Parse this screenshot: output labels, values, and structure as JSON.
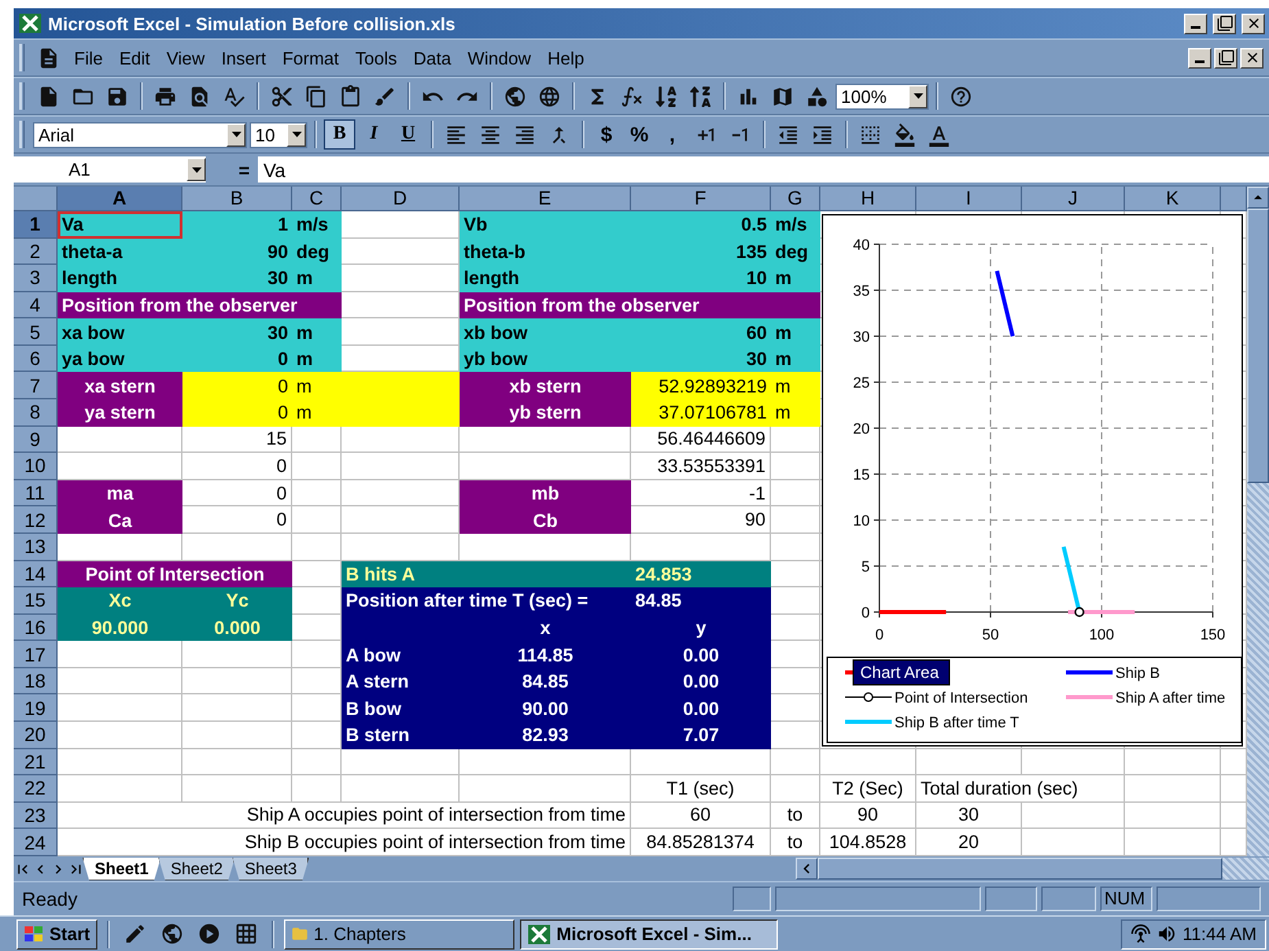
{
  "window": {
    "title": "Microsoft Excel - Simulation Before collision.xls"
  },
  "menu": [
    "File",
    "Edit",
    "View",
    "Insert",
    "Format",
    "Tools",
    "Data",
    "Window",
    "Help"
  ],
  "standard_toolbar": {
    "zoom": "100%"
  },
  "formatting_toolbar": {
    "font": "Arial",
    "size": "10",
    "style_buttons": [
      {
        "label": "B",
        "pressed": true
      },
      {
        "label": "I",
        "pressed": false
      },
      {
        "label": "U",
        "pressed": false
      }
    ],
    "number_buttons": [
      "$",
      "%",
      ","
    ]
  },
  "formula_bar": {
    "name_box": "A1",
    "equals": "=",
    "content": "Va"
  },
  "sheet": {
    "columns": [
      "A",
      "B",
      "C",
      "D",
      "E",
      "F",
      "G",
      "H",
      "I",
      "J",
      "K"
    ],
    "rows": [
      {
        "label": "1",
        "cells": [
          {
            "text": "Va",
            "kind": "label",
            "color": "#33cccc",
            "bold": true,
            "selected": true
          },
          {
            "text": "1",
            "kind": "number",
            "color": "#33cccc",
            "bold": true
          },
          {
            "text": "m/s",
            "kind": "label",
            "color": "#33cccc",
            "bold": true
          },
          {
            "kind": "empty"
          },
          {
            "text": "Vb",
            "kind": "label",
            "color": "#33cccc",
            "bold": true
          },
          {
            "text": "0.5",
            "kind": "number",
            "color": "#33cccc",
            "bold": true
          },
          {
            "text": "m/s",
            "kind": "label",
            "color": "#33cccc",
            "bold": true
          }
        ]
      },
      {
        "label": "2",
        "cells": [
          {
            "text": "theta-a",
            "kind": "label",
            "color": "#33cccc",
            "bold": true
          },
          {
            "text": "90",
            "kind": "number",
            "color": "#33cccc",
            "bold": true
          },
          {
            "text": "deg",
            "kind": "label",
            "color": "#33cccc",
            "bold": true
          },
          {
            "kind": "empty"
          },
          {
            "text": "theta-b",
            "kind": "label",
            "color": "#33cccc",
            "bold": true
          },
          {
            "text": "135",
            "kind": "number",
            "color": "#33cccc",
            "bold": true
          },
          {
            "text": "deg",
            "kind": "label",
            "color": "#33cccc",
            "bold": true
          }
        ]
      },
      {
        "label": "3",
        "cells": [
          {
            "text": "length",
            "kind": "label",
            "color": "#33cccc",
            "bold": true
          },
          {
            "text": "30",
            "kind": "number",
            "color": "#33cccc",
            "bold": true
          },
          {
            "text": "m",
            "kind": "label",
            "color": "#33cccc",
            "bold": true
          },
          {
            "kind": "empty"
          },
          {
            "text": "length",
            "kind": "label",
            "color": "#33cccc",
            "bold": true
          },
          {
            "text": "10",
            "kind": "number",
            "color": "#33cccc",
            "bold": true
          },
          {
            "text": "m",
            "kind": "label",
            "color": "#33cccc",
            "bold": true
          }
        ]
      },
      {
        "label": "4",
        "cells": [
          {
            "text": "Position from the observer",
            "kind": "label",
            "color": "#800080",
            "bold": true
          },
          {
            "joined": true
          },
          {
            "joined": true
          },
          {
            "kind": "empty"
          },
          {
            "text": "Position from the observer",
            "kind": "label",
            "color": "#800080",
            "bold": true
          },
          {
            "joined": true
          },
          {
            "joined": true
          }
        ]
      },
      {
        "label": "5",
        "cells": [
          {
            "text": "xa bow",
            "kind": "label",
            "color": "#33cccc",
            "bold": true
          },
          {
            "text": "30",
            "kind": "number",
            "color": "#33cccc",
            "bold": true
          },
          {
            "text": "m",
            "kind": "label",
            "color": "#33cccc",
            "bold": true
          },
          {
            "kind": "empty"
          },
          {
            "text": "xb bow",
            "kind": "label",
            "color": "#33cccc",
            "bold": true
          },
          {
            "text": "60",
            "kind": "number",
            "color": "#33cccc",
            "bold": true
          },
          {
            "text": "m",
            "kind": "label",
            "color": "#33cccc",
            "bold": true
          }
        ]
      },
      {
        "label": "6",
        "cells": [
          {
            "text": "ya bow",
            "kind": "label",
            "color": "#33cccc",
            "bold": true
          },
          {
            "text": "0",
            "kind": "number",
            "color": "#33cccc",
            "bold": true
          },
          {
            "text": "m",
            "kind": "label",
            "color": "#33cccc",
            "bold": true
          },
          {
            "kind": "empty"
          },
          {
            "text": "yb bow",
            "kind": "label",
            "color": "#33cccc",
            "bold": true
          },
          {
            "text": "30",
            "kind": "number",
            "color": "#33cccc",
            "bold": true
          },
          {
            "text": "m",
            "kind": "label",
            "color": "#33cccc",
            "bold": true
          }
        ]
      },
      {
        "label": "7",
        "cells": [
          {
            "text": "xa stern",
            "kind": "centered",
            "color": "#800080",
            "bold": true
          },
          {
            "text": "0",
            "kind": "number",
            "color": "#ffff00",
            "bold": false
          },
          {
            "text": "m",
            "kind": "label",
            "color": "#ffff00",
            "bold": false
          },
          {
            "kind": "empty",
            "color": "#ffff00"
          },
          {
            "text": "xb stern",
            "kind": "centered",
            "color": "#800080",
            "bold": true
          },
          {
            "text": "52.92893219",
            "kind": "number",
            "color": "#ffff00",
            "bold": false
          },
          {
            "text": "m",
            "kind": "label",
            "color": "#ffff00",
            "bold": false
          }
        ]
      },
      {
        "label": "8",
        "cells": [
          {
            "text": "ya stern",
            "kind": "centered",
            "color": "#800080",
            "bold": true
          },
          {
            "text": "0",
            "kind": "number",
            "color": "#ffff00",
            "bold": false
          },
          {
            "text": "m",
            "kind": "label",
            "color": "#ffff00",
            "bold": false
          },
          {
            "kind": "empty",
            "color": "#ffff00"
          },
          {
            "text": "yb stern",
            "kind": "centered",
            "color": "#800080",
            "bold": true
          },
          {
            "text": "37.07106781",
            "kind": "number",
            "color": "#ffff00",
            "bold": false
          },
          {
            "text": "m",
            "kind": "label",
            "color": "#ffff00",
            "bold": false
          }
        ]
      },
      {
        "label": "9",
        "cells": [
          {
            "kind": "empty"
          },
          {
            "text": "15",
            "kind": "number"
          },
          {
            "kind": "empty"
          },
          {
            "kind": "empty"
          },
          {
            "kind": "empty"
          },
          {
            "text": "56.46446609",
            "kind": "number"
          }
        ]
      },
      {
        "label": "10",
        "cells": [
          {
            "kind": "empty"
          },
          {
            "text": "0",
            "kind": "number"
          },
          {
            "kind": "empty"
          },
          {
            "kind": "empty"
          },
          {
            "kind": "empty"
          },
          {
            "text": "33.53553391",
            "kind": "number"
          }
        ]
      },
      {
        "label": "11",
        "cells": [
          {
            "text": "ma",
            "kind": "centered",
            "color": "#800080",
            "bold": true
          },
          {
            "text": "0",
            "kind": "number"
          },
          {
            "kind": "empty"
          },
          {
            "kind": "empty"
          },
          {
            "text": "mb",
            "kind": "centered",
            "color": "#800080",
            "bold": true
          },
          {
            "text": "-1",
            "kind": "number"
          }
        ]
      },
      {
        "label": "12",
        "cells": [
          {
            "text": "Ca",
            "kind": "centered",
            "color": "#800080",
            "bold": true
          },
          {
            "text": "0",
            "kind": "number"
          },
          {
            "kind": "empty"
          },
          {
            "kind": "empty"
          },
          {
            "text": "Cb",
            "kind": "centered",
            "color": "#800080",
            "bold": true
          },
          {
            "text": "90",
            "kind": "number"
          }
        ]
      },
      {
        "label": "13"
      },
      {
        "label": "14",
        "cells": [
          {
            "text": "Point of Intersection",
            "kind": "centered",
            "color": "#800080",
            "bold": true
          },
          {
            "joined": true
          },
          {
            "kind": "empty"
          },
          {
            "text": "B hits A",
            "kind": "label",
            "color": "#008080",
            "bold": true
          },
          {
            "joined": true
          },
          {
            "text": "24.853",
            "kind": "label",
            "color": "#008080",
            "bold": true
          }
        ]
      },
      {
        "label": "15",
        "cells": [
          {
            "text": "Xc",
            "kind": "centered",
            "color": "#008080",
            "bold": true
          },
          {
            "text": "Yc",
            "kind": "centered",
            "color": "#008080",
            "bold": true
          },
          {
            "kind": "empty"
          },
          {
            "text": "Position after time T (sec) =",
            "kind": "label",
            "color": "#000080",
            "bold": true
          },
          {
            "joined": true
          },
          {
            "text": "84.85",
            "kind": "label",
            "color": "#000080",
            "bold": true
          }
        ]
      },
      {
        "label": "16",
        "cells": [
          {
            "text": "90.000",
            "kind": "centered",
            "color": "#008080",
            "bold": true
          },
          {
            "text": "0.000",
            "kind": "centered",
            "color": "#008080",
            "bold": true
          },
          {
            "kind": "empty"
          },
          {
            "kind": "empty",
            "color": "#000080"
          },
          {
            "text": "x",
            "kind": "centered",
            "color": "#000080",
            "bold": true
          },
          {
            "text": "y",
            "kind": "centered",
            "color": "#000080",
            "bold": true
          }
        ]
      },
      {
        "label": "17",
        "cells": [
          {
            "kind": "empty"
          },
          {
            "kind": "empty"
          },
          {
            "kind": "empty"
          },
          {
            "text": "A bow",
            "kind": "label",
            "color": "#000080",
            "bold": true
          },
          {
            "text": "114.85",
            "kind": "centered",
            "color": "#000080",
            "bold": true
          },
          {
            "text": "0.00",
            "kind": "centered",
            "color": "#000080",
            "bold": true
          }
        ]
      },
      {
        "label": "18",
        "cells": [
          {
            "kind": "empty"
          },
          {
            "kind": "empty"
          },
          {
            "kind": "empty"
          },
          {
            "text": "A stern",
            "kind": "label",
            "color": "#000080",
            "bold": true
          },
          {
            "text": "84.85",
            "kind": "centered",
            "color": "#000080",
            "bold": true
          },
          {
            "text": "0.00",
            "kind": "centered",
            "color": "#000080",
            "bold": true
          }
        ]
      },
      {
        "label": "19",
        "cells": [
          {
            "kind": "empty"
          },
          {
            "kind": "empty"
          },
          {
            "kind": "empty"
          },
          {
            "text": "B bow",
            "kind": "label",
            "color": "#000080",
            "bold": true
          },
          {
            "text": "90.00",
            "kind": "centered",
            "color": "#000080",
            "bold": true
          },
          {
            "text": "0.00",
            "kind": "centered",
            "color": "#000080",
            "bold": true
          }
        ]
      },
      {
        "label": "20",
        "cells": [
          {
            "kind": "empty"
          },
          {
            "kind": "empty"
          },
          {
            "kind": "empty"
          },
          {
            "text": "B stern",
            "kind": "label",
            "color": "#000080",
            "bold": true
          },
          {
            "text": "82.93",
            "kind": "centered",
            "color": "#000080",
            "bold": true
          },
          {
            "text": "7.07",
            "kind": "centered",
            "color": "#000080",
            "bold": true
          }
        ]
      },
      {
        "label": "21"
      },
      {
        "label": "22",
        "cells": [
          {
            "kind": "empty"
          },
          {
            "kind": "empty"
          },
          {
            "kind": "empty"
          },
          {
            "kind": "empty"
          },
          {
            "kind": "empty"
          },
          {
            "text": "T1 (sec)",
            "kind": "centered"
          },
          {
            "kind": "empty"
          },
          {
            "text": "T2 (Sec)",
            "kind": "centered"
          },
          {
            "text": "Total duration (sec)",
            "kind": "label"
          },
          {
            "joined": true
          }
        ]
      },
      {
        "label": "23",
        "cells": [
          {
            "text": "Ship A occupies point of intersection from time",
            "kind": "number"
          },
          {
            "joined": true
          },
          {
            "joined": true
          },
          {
            "joined": true
          },
          {
            "joined": true
          },
          {
            "text": "60",
            "kind": "centered"
          },
          {
            "text": "to",
            "kind": "centered"
          },
          {
            "text": "90",
            "kind": "centered"
          },
          {
            "text": "30",
            "kind": "centered"
          }
        ]
      },
      {
        "label": "24",
        "cells": [
          {
            "text": "Ship B occupies point of intersection from time",
            "kind": "number"
          },
          {
            "joined": true
          },
          {
            "joined": true
          },
          {
            "joined": true
          },
          {
            "joined": true
          },
          {
            "text": "84.85281374",
            "kind": "centered"
          },
          {
            "text": "to",
            "kind": "centered"
          },
          {
            "text": "104.8528",
            "kind": "centered"
          },
          {
            "text": "20",
            "kind": "centered"
          }
        ]
      }
    ]
  },
  "chart": {
    "tooltip": "Chart Area",
    "chart_data": {
      "type": "line",
      "grid": true,
      "legend": true,
      "xlim": [
        0,
        150
      ],
      "ylim": [
        0,
        40
      ],
      "xticks": [
        {
          "value": 0,
          "label": "0"
        },
        {
          "value": 50,
          "label": "50"
        },
        {
          "value": 100,
          "label": "100"
        },
        {
          "value": 150,
          "label": "150"
        }
      ],
      "yticks": [
        {
          "value": 0,
          "label": "0"
        },
        {
          "value": 5,
          "label": "5"
        },
        {
          "value": 10,
          "label": "10"
        },
        {
          "value": 15,
          "label": "15"
        },
        {
          "value": 20,
          "label": "20"
        },
        {
          "value": 25,
          "label": "25"
        },
        {
          "value": 30,
          "label": "30"
        },
        {
          "value": 35,
          "label": "35"
        },
        {
          "value": 40,
          "label": "40"
        }
      ],
      "series": [
        {
          "color": "#ff0000",
          "x": [
            0,
            30
          ],
          "values": [
            0,
            0
          ]
        },
        {
          "name": "Ship B",
          "color": "#0000ff",
          "x": [
            60,
            52.9
          ],
          "values": [
            30,
            37.1
          ]
        },
        {
          "name": "Point of Intersection",
          "color": "#000000",
          "marker": true,
          "x": [
            90
          ],
          "values": [
            0
          ]
        },
        {
          "name": "Ship A after time",
          "color": "#ff99cc",
          "x": [
            84.9,
            114.9
          ],
          "values": [
            0,
            0
          ]
        },
        {
          "name": "Ship B after time T",
          "color": "#00ccff",
          "x": [
            90,
            82.9
          ],
          "values": [
            0,
            7.1
          ]
        }
      ]
    }
  },
  "sheet_tabs": [
    {
      "label": "Sheet1",
      "selected": true
    },
    {
      "label": "Sheet2",
      "selected": false
    },
    {
      "label": "Sheet3",
      "selected": false
    }
  ],
  "status_bar": {
    "text": "Ready",
    "indicator": "NUM"
  },
  "taskbar": {
    "start": "Start",
    "tasks": [
      {
        "label": "1. Chapters",
        "kind": "folder",
        "selected": false
      },
      {
        "label": "Microsoft Excel - Sim...",
        "kind": "excel",
        "selected": true
      }
    ],
    "clock": "11:44 AM"
  }
}
